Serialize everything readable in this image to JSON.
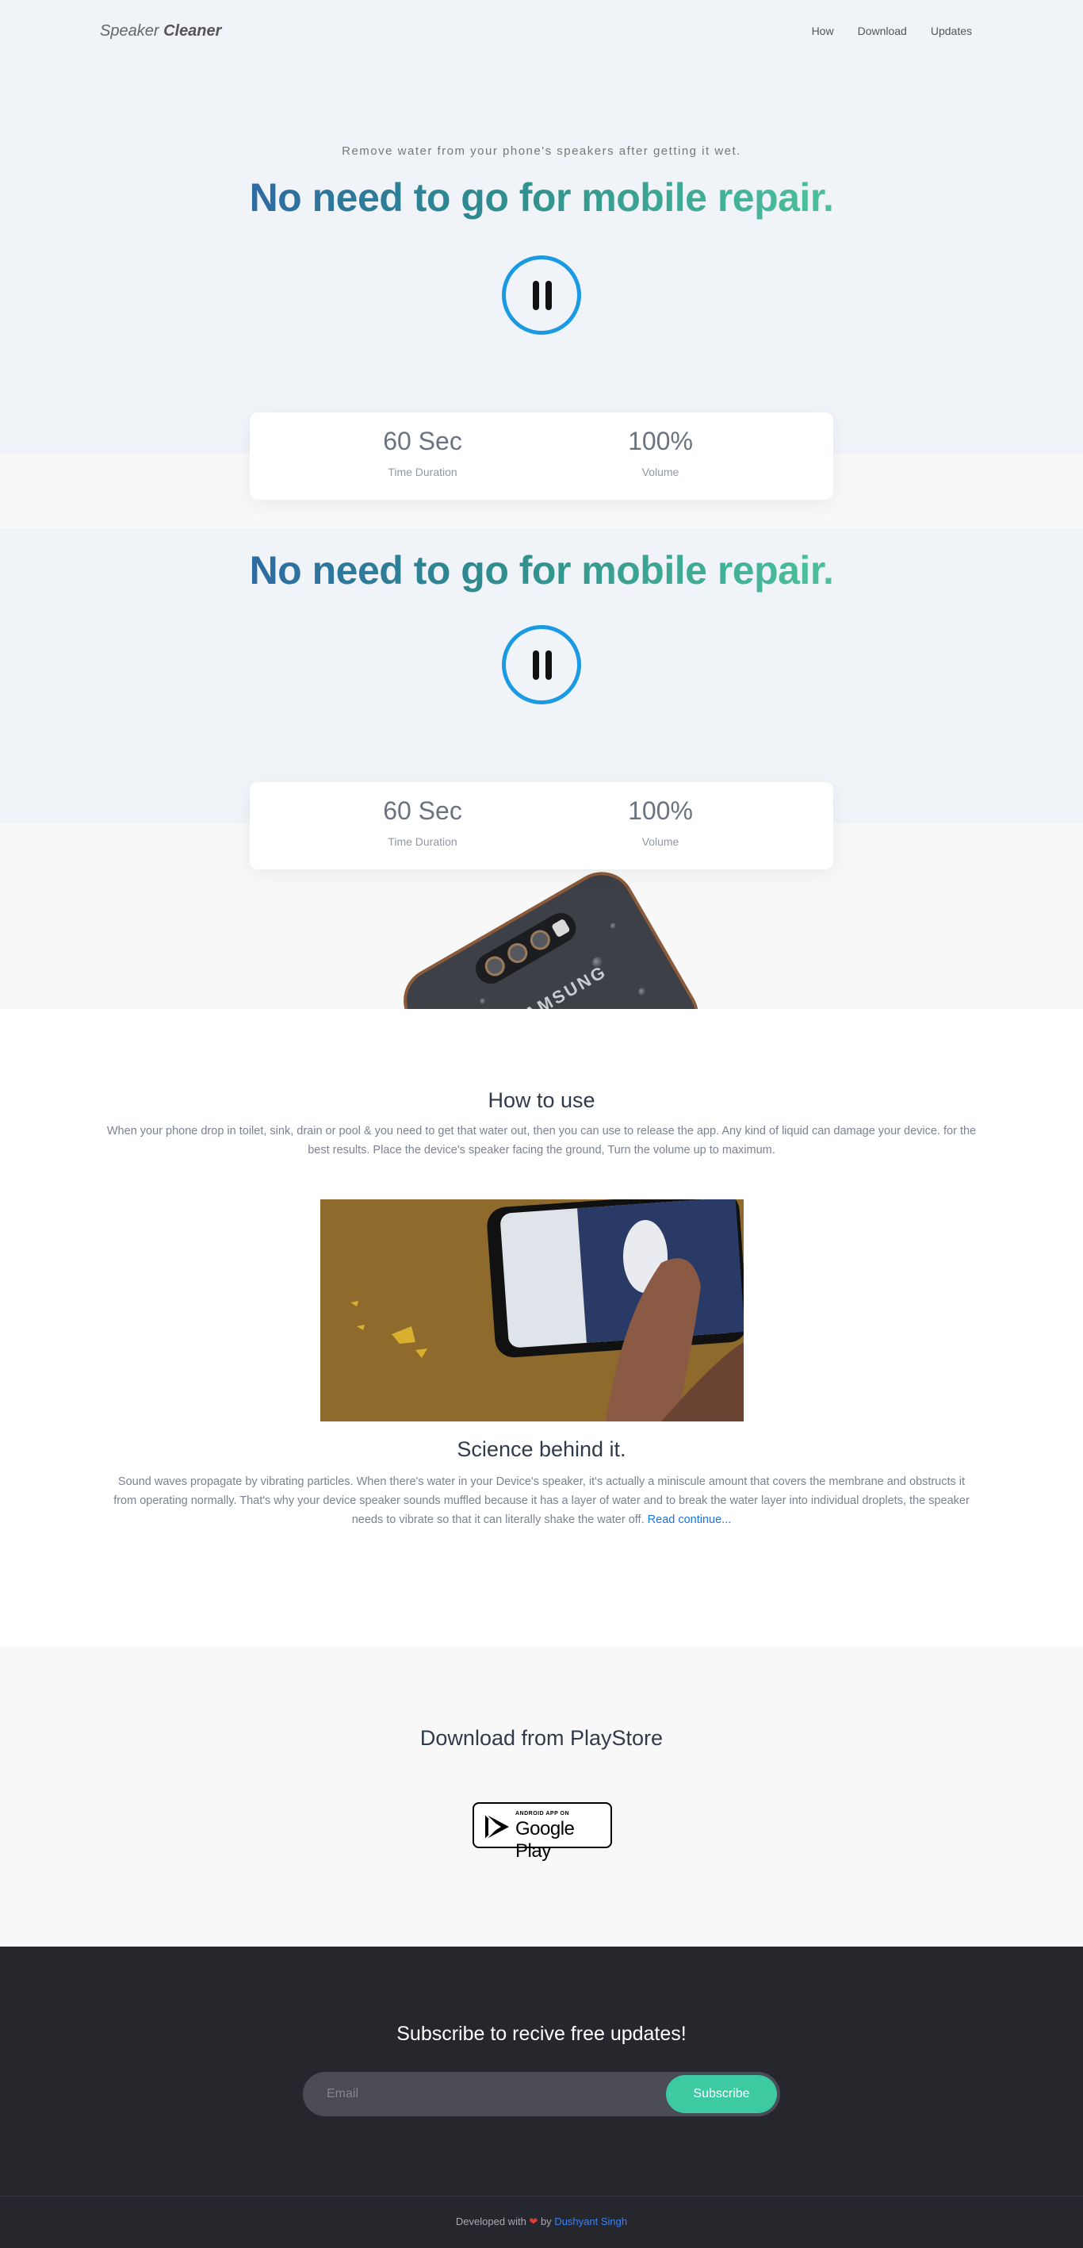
{
  "nav": {
    "brand_light": "Speaker",
    "brand_bold": "Cleaner",
    "links": [
      "How",
      "Download",
      "Updates"
    ]
  },
  "hero": {
    "tagline": "Remove water from your phone's speakers after getting it wet.",
    "headline": "No need to go for mobile repair.",
    "stats": [
      {
        "value": "60 Sec",
        "label": "Time Duration"
      },
      {
        "value": "100%",
        "label": "Volume"
      }
    ]
  },
  "how": {
    "title": "How to use",
    "text": "When your phone drop in toilet, sink, drain or pool & you need to get that water out, then you can use to release the app. Any kind of liquid can damage your device. for the best results. Place the device's speaker facing the ground, Turn the volume up to maximum.",
    "science_title": "Science behind it.",
    "science_text": "Sound waves propagate by vibrating particles. When there's water in your Device's speaker, it's actually a miniscule amount that covers the membrane and obstructs it from operating normally. That's why your device speaker sounds muffled because it has a layer of water and to break the water layer into individual droplets, the speaker needs to vibrate so that it can literally shake the water off.",
    "read_more": "Read continue..."
  },
  "download": {
    "title": "Download from PlayStore",
    "badge_small": "ANDROID APP ON",
    "badge_big": "Google Play"
  },
  "subscribe": {
    "title": "Subscribe to recive free updates!",
    "placeholder": "Email",
    "button": "Subscribe"
  },
  "footer": {
    "developed": "Developed with",
    "heart": "❤",
    "by": "by",
    "author": "Dushyant Singh"
  },
  "colors": {
    "accent_blue": "#1a9ae2",
    "accent_green": "#3dcaa0",
    "dark_bg": "#26262d"
  }
}
